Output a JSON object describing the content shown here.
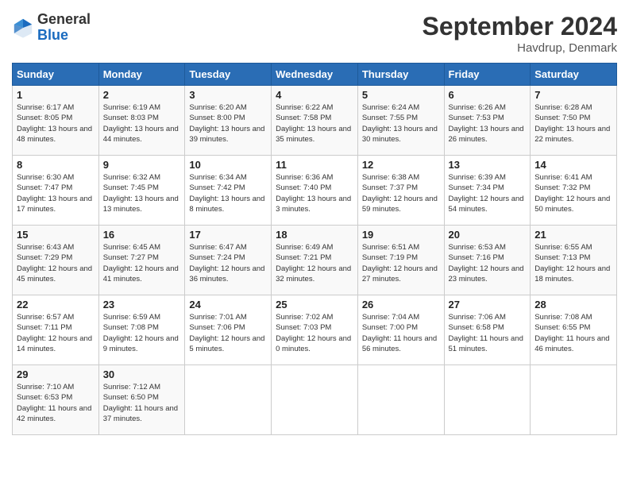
{
  "header": {
    "logo_general": "General",
    "logo_blue": "Blue",
    "month_title": "September 2024",
    "location": "Havdrup, Denmark"
  },
  "days_of_week": [
    "Sunday",
    "Monday",
    "Tuesday",
    "Wednesday",
    "Thursday",
    "Friday",
    "Saturday"
  ],
  "weeks": [
    [
      {
        "day": "1",
        "sunrise": "6:17 AM",
        "sunset": "8:05 PM",
        "daylight": "13 hours and 48 minutes."
      },
      {
        "day": "2",
        "sunrise": "6:19 AM",
        "sunset": "8:03 PM",
        "daylight": "13 hours and 44 minutes."
      },
      {
        "day": "3",
        "sunrise": "6:20 AM",
        "sunset": "8:00 PM",
        "daylight": "13 hours and 39 minutes."
      },
      {
        "day": "4",
        "sunrise": "6:22 AM",
        "sunset": "7:58 PM",
        "daylight": "13 hours and 35 minutes."
      },
      {
        "day": "5",
        "sunrise": "6:24 AM",
        "sunset": "7:55 PM",
        "daylight": "13 hours and 30 minutes."
      },
      {
        "day": "6",
        "sunrise": "6:26 AM",
        "sunset": "7:53 PM",
        "daylight": "13 hours and 26 minutes."
      },
      {
        "day": "7",
        "sunrise": "6:28 AM",
        "sunset": "7:50 PM",
        "daylight": "13 hours and 22 minutes."
      }
    ],
    [
      {
        "day": "8",
        "sunrise": "6:30 AM",
        "sunset": "7:47 PM",
        "daylight": "13 hours and 17 minutes."
      },
      {
        "day": "9",
        "sunrise": "6:32 AM",
        "sunset": "7:45 PM",
        "daylight": "13 hours and 13 minutes."
      },
      {
        "day": "10",
        "sunrise": "6:34 AM",
        "sunset": "7:42 PM",
        "daylight": "13 hours and 8 minutes."
      },
      {
        "day": "11",
        "sunrise": "6:36 AM",
        "sunset": "7:40 PM",
        "daylight": "13 hours and 3 minutes."
      },
      {
        "day": "12",
        "sunrise": "6:38 AM",
        "sunset": "7:37 PM",
        "daylight": "12 hours and 59 minutes."
      },
      {
        "day": "13",
        "sunrise": "6:39 AM",
        "sunset": "7:34 PM",
        "daylight": "12 hours and 54 minutes."
      },
      {
        "day": "14",
        "sunrise": "6:41 AM",
        "sunset": "7:32 PM",
        "daylight": "12 hours and 50 minutes."
      }
    ],
    [
      {
        "day": "15",
        "sunrise": "6:43 AM",
        "sunset": "7:29 PM",
        "daylight": "12 hours and 45 minutes."
      },
      {
        "day": "16",
        "sunrise": "6:45 AM",
        "sunset": "7:27 PM",
        "daylight": "12 hours and 41 minutes."
      },
      {
        "day": "17",
        "sunrise": "6:47 AM",
        "sunset": "7:24 PM",
        "daylight": "12 hours and 36 minutes."
      },
      {
        "day": "18",
        "sunrise": "6:49 AM",
        "sunset": "7:21 PM",
        "daylight": "12 hours and 32 minutes."
      },
      {
        "day": "19",
        "sunrise": "6:51 AM",
        "sunset": "7:19 PM",
        "daylight": "12 hours and 27 minutes."
      },
      {
        "day": "20",
        "sunrise": "6:53 AM",
        "sunset": "7:16 PM",
        "daylight": "12 hours and 23 minutes."
      },
      {
        "day": "21",
        "sunrise": "6:55 AM",
        "sunset": "7:13 PM",
        "daylight": "12 hours and 18 minutes."
      }
    ],
    [
      {
        "day": "22",
        "sunrise": "6:57 AM",
        "sunset": "7:11 PM",
        "daylight": "12 hours and 14 minutes."
      },
      {
        "day": "23",
        "sunrise": "6:59 AM",
        "sunset": "7:08 PM",
        "daylight": "12 hours and 9 minutes."
      },
      {
        "day": "24",
        "sunrise": "7:01 AM",
        "sunset": "7:06 PM",
        "daylight": "12 hours and 5 minutes."
      },
      {
        "day": "25",
        "sunrise": "7:02 AM",
        "sunset": "7:03 PM",
        "daylight": "12 hours and 0 minutes."
      },
      {
        "day": "26",
        "sunrise": "7:04 AM",
        "sunset": "7:00 PM",
        "daylight": "11 hours and 56 minutes."
      },
      {
        "day": "27",
        "sunrise": "7:06 AM",
        "sunset": "6:58 PM",
        "daylight": "11 hours and 51 minutes."
      },
      {
        "day": "28",
        "sunrise": "7:08 AM",
        "sunset": "6:55 PM",
        "daylight": "11 hours and 46 minutes."
      }
    ],
    [
      {
        "day": "29",
        "sunrise": "7:10 AM",
        "sunset": "6:53 PM",
        "daylight": "11 hours and 42 minutes."
      },
      {
        "day": "30",
        "sunrise": "7:12 AM",
        "sunset": "6:50 PM",
        "daylight": "11 hours and 37 minutes."
      },
      null,
      null,
      null,
      null,
      null
    ]
  ]
}
